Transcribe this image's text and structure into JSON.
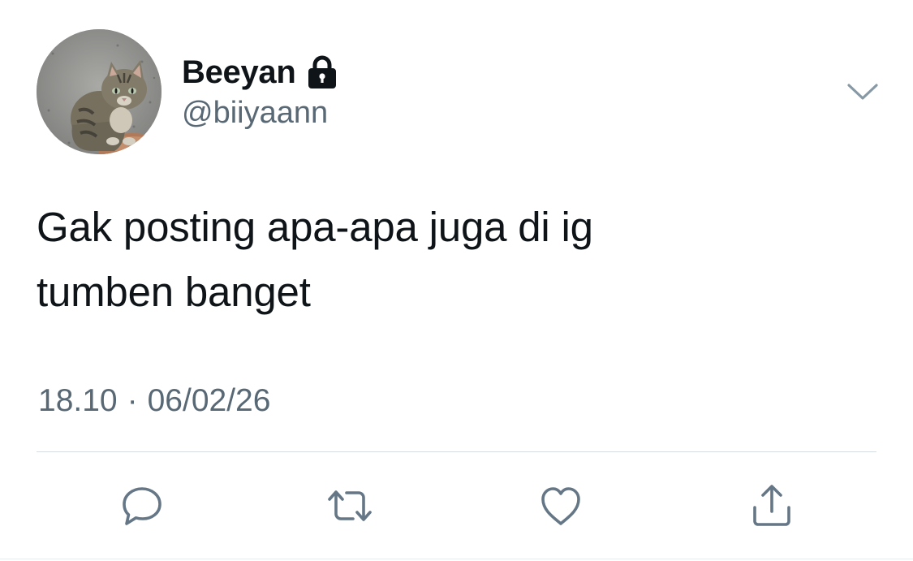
{
  "user": {
    "display_name": "Beeyan",
    "handle": "@biiyaann",
    "protected_icon": "lock-icon",
    "avatar": "cat-photo"
  },
  "tweet": {
    "text_lines": [
      "Gak posting apa-apa juga di ig",
      "tumben banget"
    ],
    "time": "18.10",
    "separator": "·",
    "date": "06/02/26"
  },
  "icons": {
    "menu": "chevron-down-icon",
    "reply": "reply-icon",
    "retweet": "retweet-icon",
    "like": "heart-icon",
    "share": "share-icon"
  },
  "colors": {
    "text_primary": "#0f1419",
    "text_secondary": "#586874",
    "icon": "#657786",
    "divider": "#d6dde2"
  }
}
